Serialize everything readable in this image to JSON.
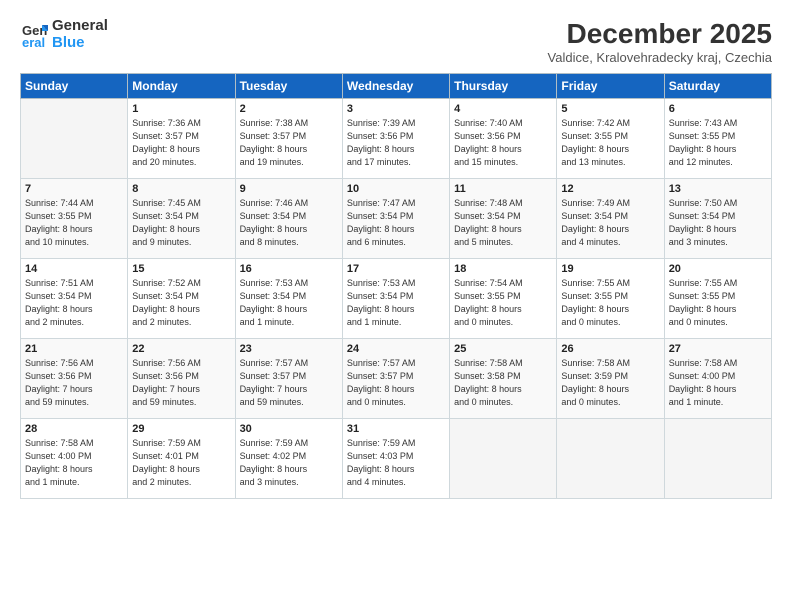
{
  "header": {
    "logo_line1": "General",
    "logo_line2": "Blue",
    "title": "December 2025",
    "subtitle": "Valdice, Kralovehradecky kraj, Czechia"
  },
  "columns": [
    "Sunday",
    "Monday",
    "Tuesday",
    "Wednesday",
    "Thursday",
    "Friday",
    "Saturday"
  ],
  "weeks": [
    [
      {
        "day": "",
        "data": ""
      },
      {
        "day": "1",
        "data": "Sunrise: 7:36 AM\nSunset: 3:57 PM\nDaylight: 8 hours\nand 20 minutes."
      },
      {
        "day": "2",
        "data": "Sunrise: 7:38 AM\nSunset: 3:57 PM\nDaylight: 8 hours\nand 19 minutes."
      },
      {
        "day": "3",
        "data": "Sunrise: 7:39 AM\nSunset: 3:56 PM\nDaylight: 8 hours\nand 17 minutes."
      },
      {
        "day": "4",
        "data": "Sunrise: 7:40 AM\nSunset: 3:56 PM\nDaylight: 8 hours\nand 15 minutes."
      },
      {
        "day": "5",
        "data": "Sunrise: 7:42 AM\nSunset: 3:55 PM\nDaylight: 8 hours\nand 13 minutes."
      },
      {
        "day": "6",
        "data": "Sunrise: 7:43 AM\nSunset: 3:55 PM\nDaylight: 8 hours\nand 12 minutes."
      }
    ],
    [
      {
        "day": "7",
        "data": "Sunrise: 7:44 AM\nSunset: 3:55 PM\nDaylight: 8 hours\nand 10 minutes."
      },
      {
        "day": "8",
        "data": "Sunrise: 7:45 AM\nSunset: 3:54 PM\nDaylight: 8 hours\nand 9 minutes."
      },
      {
        "day": "9",
        "data": "Sunrise: 7:46 AM\nSunset: 3:54 PM\nDaylight: 8 hours\nand 8 minutes."
      },
      {
        "day": "10",
        "data": "Sunrise: 7:47 AM\nSunset: 3:54 PM\nDaylight: 8 hours\nand 6 minutes."
      },
      {
        "day": "11",
        "data": "Sunrise: 7:48 AM\nSunset: 3:54 PM\nDaylight: 8 hours\nand 5 minutes."
      },
      {
        "day": "12",
        "data": "Sunrise: 7:49 AM\nSunset: 3:54 PM\nDaylight: 8 hours\nand 4 minutes."
      },
      {
        "day": "13",
        "data": "Sunrise: 7:50 AM\nSunset: 3:54 PM\nDaylight: 8 hours\nand 3 minutes."
      }
    ],
    [
      {
        "day": "14",
        "data": "Sunrise: 7:51 AM\nSunset: 3:54 PM\nDaylight: 8 hours\nand 2 minutes."
      },
      {
        "day": "15",
        "data": "Sunrise: 7:52 AM\nSunset: 3:54 PM\nDaylight: 8 hours\nand 2 minutes."
      },
      {
        "day": "16",
        "data": "Sunrise: 7:53 AM\nSunset: 3:54 PM\nDaylight: 8 hours\nand 1 minute."
      },
      {
        "day": "17",
        "data": "Sunrise: 7:53 AM\nSunset: 3:54 PM\nDaylight: 8 hours\nand 1 minute."
      },
      {
        "day": "18",
        "data": "Sunrise: 7:54 AM\nSunset: 3:55 PM\nDaylight: 8 hours\nand 0 minutes."
      },
      {
        "day": "19",
        "data": "Sunrise: 7:55 AM\nSunset: 3:55 PM\nDaylight: 8 hours\nand 0 minutes."
      },
      {
        "day": "20",
        "data": "Sunrise: 7:55 AM\nSunset: 3:55 PM\nDaylight: 8 hours\nand 0 minutes."
      }
    ],
    [
      {
        "day": "21",
        "data": "Sunrise: 7:56 AM\nSunset: 3:56 PM\nDaylight: 7 hours\nand 59 minutes."
      },
      {
        "day": "22",
        "data": "Sunrise: 7:56 AM\nSunset: 3:56 PM\nDaylight: 7 hours\nand 59 minutes."
      },
      {
        "day": "23",
        "data": "Sunrise: 7:57 AM\nSunset: 3:57 PM\nDaylight: 7 hours\nand 59 minutes."
      },
      {
        "day": "24",
        "data": "Sunrise: 7:57 AM\nSunset: 3:57 PM\nDaylight: 8 hours\nand 0 minutes."
      },
      {
        "day": "25",
        "data": "Sunrise: 7:58 AM\nSunset: 3:58 PM\nDaylight: 8 hours\nand 0 minutes."
      },
      {
        "day": "26",
        "data": "Sunrise: 7:58 AM\nSunset: 3:59 PM\nDaylight: 8 hours\nand 0 minutes."
      },
      {
        "day": "27",
        "data": "Sunrise: 7:58 AM\nSunset: 4:00 PM\nDaylight: 8 hours\nand 1 minute."
      }
    ],
    [
      {
        "day": "28",
        "data": "Sunrise: 7:58 AM\nSunset: 4:00 PM\nDaylight: 8 hours\nand 1 minute."
      },
      {
        "day": "29",
        "data": "Sunrise: 7:59 AM\nSunset: 4:01 PM\nDaylight: 8 hours\nand 2 minutes."
      },
      {
        "day": "30",
        "data": "Sunrise: 7:59 AM\nSunset: 4:02 PM\nDaylight: 8 hours\nand 3 minutes."
      },
      {
        "day": "31",
        "data": "Sunrise: 7:59 AM\nSunset: 4:03 PM\nDaylight: 8 hours\nand 4 minutes."
      },
      {
        "day": "",
        "data": ""
      },
      {
        "day": "",
        "data": ""
      },
      {
        "day": "",
        "data": ""
      }
    ]
  ]
}
